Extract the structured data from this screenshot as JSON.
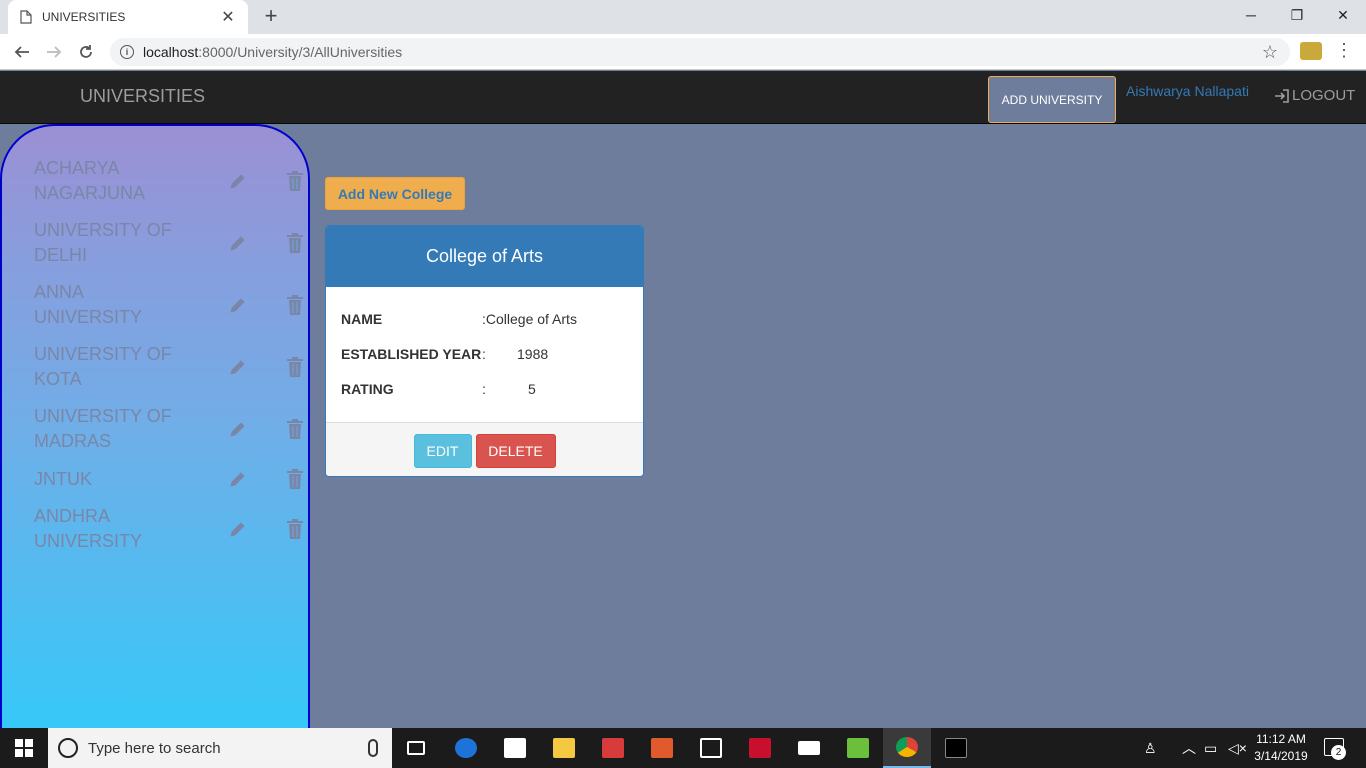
{
  "browser": {
    "tab_title": "UNIVERSITIES",
    "url_host": "localhost",
    "url_path": ":8000/University/3/AllUniversities"
  },
  "navbar": {
    "brand": "UNIVERSITIES",
    "add_university": "ADD UNIVERSITY",
    "user": "Aishwarya Nallapati",
    "logout": "LOGOUT"
  },
  "sidebar": {
    "universities": [
      {
        "line1": "ACHARYA",
        "line2": "NAGARJUNA"
      },
      {
        "line1": "UNIVERSITY OF",
        "line2": "DELHI"
      },
      {
        "line1": "ANNA",
        "line2": "UNIVERSITY"
      },
      {
        "line1": "UNIVERSITY OF",
        "line2": "KOTA"
      },
      {
        "line1": "UNIVERSITY OF",
        "line2": "MADRAS"
      },
      {
        "line1": "JNTUK",
        "line2": ""
      },
      {
        "line1": "ANDHRA",
        "line2": "UNIVERSITY"
      }
    ]
  },
  "main": {
    "add_college": "Add New College",
    "card": {
      "title": "College of Arts",
      "name_label": "NAME",
      "name_value": ":College of Arts",
      "year_label": "ESTABLISHED YEAR",
      "year_value": "1988",
      "rating_label": "RATING",
      "rating_value": "5",
      "colon": ":",
      "edit": "EDIT",
      "delete": "DELETE"
    }
  },
  "taskbar": {
    "search_placeholder": "Type here to search",
    "time": "11:12 AM",
    "date": "3/14/2019",
    "notifications": "2"
  },
  "colors": {
    "page_bg": "#6f7d9c",
    "navbar_bg": "#222222",
    "accent_blue": "#337ab7",
    "warning": "#f0ad4e",
    "info": "#5bc0de",
    "danger": "#d9534f"
  }
}
